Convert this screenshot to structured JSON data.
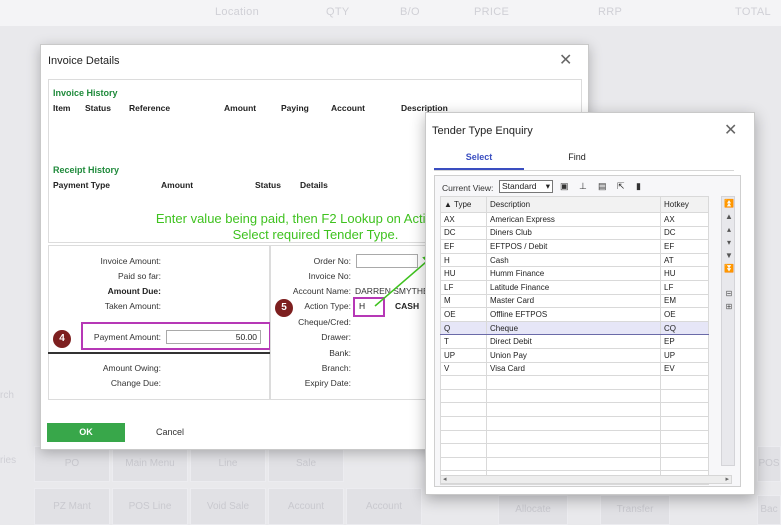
{
  "background": {
    "headers": [
      "Location",
      "QTY",
      "B/O",
      "PRICE",
      "RRP",
      "TOTAL"
    ],
    "side_labels": [
      "rch",
      "ries"
    ],
    "tiles": [
      {
        "text": "PO"
      },
      {
        "text": "Main Menu"
      },
      {
        "text": "Line"
      },
      {
        "text": "Sale"
      },
      {
        "text": "POS"
      },
      {
        "text": "PZ Mant"
      },
      {
        "text": "POS Line"
      },
      {
        "text": "Void Sale"
      },
      {
        "text": "Account"
      },
      {
        "text": "Account"
      },
      {
        "text": "Allocate"
      },
      {
        "text": "Transfer"
      },
      {
        "text": "Bac"
      }
    ]
  },
  "invoice_dialog": {
    "title": "Invoice Details",
    "invoice_history": {
      "title": "Invoice History",
      "columns": [
        "Item",
        "Status",
        "Reference",
        "Amount",
        "Paying",
        "Account",
        "Description"
      ]
    },
    "receipt_history": {
      "title": "Receipt History",
      "columns": [
        "Payment Type",
        "Amount",
        "Status",
        "Details"
      ]
    },
    "instruction": [
      "Enter value being paid, then F2 Lookup on Action Type.",
      "Select required Tender Type."
    ],
    "left_fields": {
      "invoice_amount": "Invoice Amount:",
      "paid_so_far": "Paid so far:",
      "amount_due": "Amount Due:",
      "taken_amount": "Taken Amount:",
      "payment_amount": "Payment Amount:",
      "payment_amount_value": "50.00",
      "amount_owing": "Amount Owing:",
      "change_due": "Change Due:"
    },
    "right_fields": {
      "order_no": "Order No:",
      "invoice_no": "Invoice No:",
      "account_name": "Account Name:",
      "account_name_value": "DARREN SMYTHE",
      "action_type": "Action Type:",
      "action_type_value": "H",
      "action_type_desc": "CASH",
      "cheque_cred": "Cheque/Cred:",
      "drawer": "Drawer:",
      "bank": "Bank:",
      "branch": "Branch:",
      "expiry_date": "Expiry Date:"
    },
    "badges": {
      "payment": "4",
      "action": "5"
    },
    "ok_label": "OK",
    "cancel_label": "Cancel",
    "colors": {
      "ok": "#38a74a",
      "highlight": "#b638b6",
      "instruction": "#3fc21f",
      "section": "#1f8a3b"
    }
  },
  "tender_dialog": {
    "title": "Tender Type Enquiry",
    "tabs": {
      "select": "Select",
      "find": "Find"
    },
    "current_view_label": "Current View:",
    "current_view_value": "Standard",
    "columns": {
      "type": "▲ Type",
      "description": "Description",
      "hotkey": "Hotkey"
    },
    "rows": [
      {
        "type": "AX",
        "description": "American Express",
        "hotkey": "AX"
      },
      {
        "type": "DC",
        "description": "Diners Club",
        "hotkey": "DC"
      },
      {
        "type": "EF",
        "description": "EFTPOS / Debit",
        "hotkey": "EF"
      },
      {
        "type": "H",
        "description": "Cash",
        "hotkey": "AT"
      },
      {
        "type": "HU",
        "description": "Humm Finance",
        "hotkey": "HU"
      },
      {
        "type": "LF",
        "description": "Latitude Finance",
        "hotkey": "LF"
      },
      {
        "type": "M",
        "description": "Master Card",
        "hotkey": "EM"
      },
      {
        "type": "OE",
        "description": "Offline EFTPOS",
        "hotkey": "OE"
      },
      {
        "type": "Q",
        "description": "Cheque",
        "hotkey": "CQ"
      },
      {
        "type": "T",
        "description": "Direct Debit",
        "hotkey": "EP"
      },
      {
        "type": "UP",
        "description": "Union Pay",
        "hotkey": "UP"
      },
      {
        "type": "V",
        "description": "Visa Card",
        "hotkey": "EV"
      }
    ],
    "selected_row": 8,
    "accent_color": "#3a4ec0",
    "arrow_color": "#3fc21f"
  }
}
